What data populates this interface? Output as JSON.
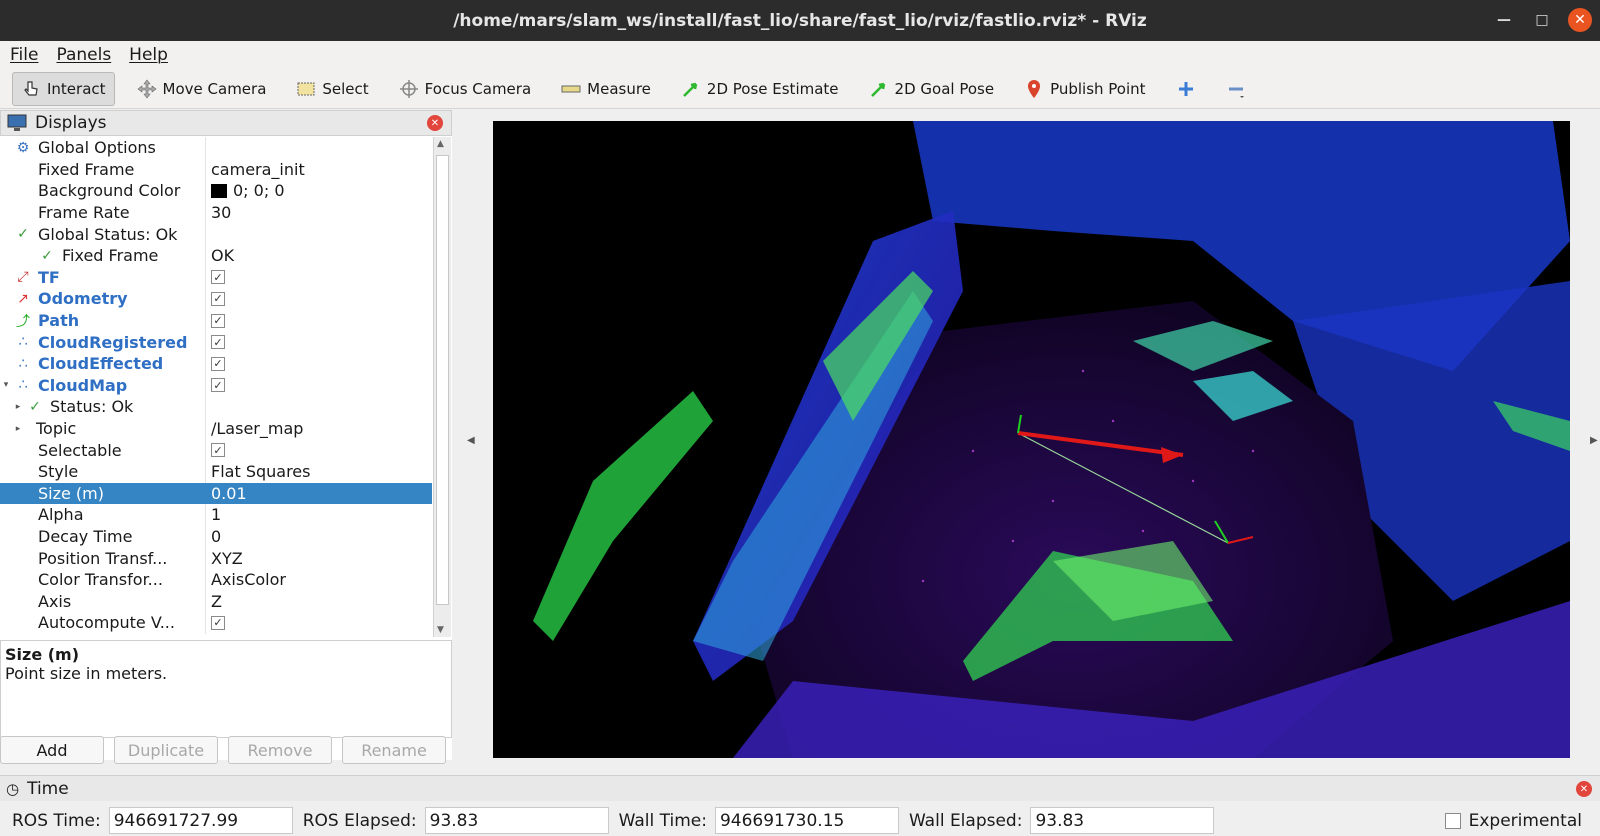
{
  "window": {
    "title": "/home/mars/slam_ws/install/fast_lio/share/fast_lio/rviz/fastlio.rviz* - RViz"
  },
  "menu": [
    "File",
    "Panels",
    "Help"
  ],
  "toolbar": {
    "interact": "Interact",
    "move_camera": "Move Camera",
    "select": "Select",
    "focus_camera": "Focus Camera",
    "measure": "Measure",
    "pose_estimate": "2D Pose Estimate",
    "goal_pose": "2D Goal Pose",
    "publish_point": "Publish Point"
  },
  "displays": {
    "title": "Displays",
    "rows": {
      "global_options": "Global Options",
      "fixed_frame": {
        "k": "Fixed Frame",
        "v": "camera_init"
      },
      "background_color": {
        "k": "Background Color",
        "v": "0; 0; 0"
      },
      "frame_rate": {
        "k": "Frame Rate",
        "v": "30"
      },
      "global_status": "Global Status: Ok",
      "fixed_frame_status": {
        "k": "Fixed Frame",
        "v": "OK"
      },
      "tf": "TF",
      "odometry": "Odometry",
      "path": "Path",
      "cloud_registered": "CloudRegistered",
      "cloud_effected": "CloudEffected",
      "cloud_map": "CloudMap",
      "status": "Status: Ok",
      "topic": {
        "k": "Topic",
        "v": "/Laser_map"
      },
      "selectable": "Selectable",
      "style": {
        "k": "Style",
        "v": "Flat Squares"
      },
      "size": {
        "k": "Size (m)",
        "v": "0.01"
      },
      "alpha": {
        "k": "Alpha",
        "v": "1"
      },
      "decay_time": {
        "k": "Decay Time",
        "v": "0"
      },
      "position_transformer": {
        "k": "Position Transf...",
        "v": "XYZ"
      },
      "color_transformer": {
        "k": "Color Transfor...",
        "v": "AxisColor"
      },
      "axis": {
        "k": "Axis",
        "v": "Z"
      },
      "autocompute": "Autocompute V..."
    },
    "help_title": "Size (m)",
    "help_text": "Point size in meters.",
    "buttons": {
      "add": "Add",
      "duplicate": "Duplicate",
      "remove": "Remove",
      "rename": "Rename"
    }
  },
  "time": {
    "title": "Time",
    "ros_time_label": "ROS Time:",
    "ros_time": "946691727.99",
    "ros_elapsed_label": "ROS Elapsed:",
    "ros_elapsed": "93.83",
    "wall_time_label": "Wall Time:",
    "wall_time": "946691730.15",
    "wall_elapsed_label": "Wall Elapsed:",
    "wall_elapsed": "93.83",
    "experimental": "Experimental"
  },
  "colors": {
    "selection": "#3584c4",
    "viewport_bg": "#000000",
    "close_button": "#e95420"
  }
}
